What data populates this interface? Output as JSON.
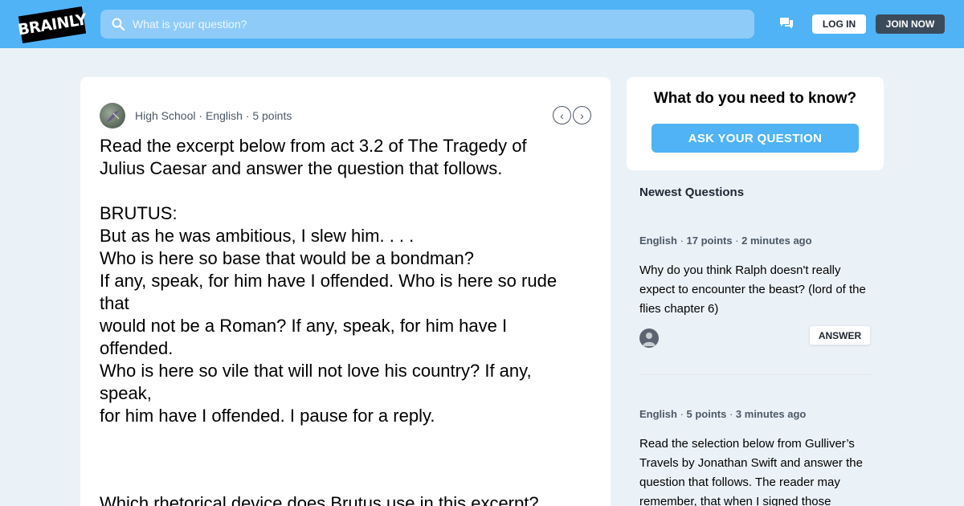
{
  "header": {
    "logo_text": "BRAINLY",
    "search_placeholder": "What is your question?",
    "login_label": "LOG IN",
    "join_label": "JOIN NOW",
    "icons": [
      "search-icon",
      "messages-icon"
    ],
    "colors": {
      "bar": "#4fb3f6",
      "join_bg": "#3c4b5b"
    }
  },
  "question": {
    "level": "High School",
    "subject": "English",
    "points": "5 points",
    "prev_glyph": "‹",
    "next_glyph": "›",
    "body": "Read the excerpt below from act 3.2 of The Tragedy of\nJulius Caesar and answer the question that follows.\n\nBRUTUS:\nBut as he was ambitious, I slew him. . . .\nWho is here so base that would be a bondman?\nIf any, speak, for him have I offended. Who is here so rude\nthat\nwould not be a Roman? If any, speak, for him have I\noffended.\nWho is here so vile that will not love his country? If any,\nspeak,\nfor him have I offended. I pause for a reply.",
    "prompt": "Which rhetorical device does Brutus use in this excerpt?"
  },
  "sidebar": {
    "ask_title": "What do you need to know?",
    "ask_button": "ASK YOUR QUESTION",
    "newest_title": "Newest Questions",
    "items": [
      {
        "subject": "English",
        "points": "17 points",
        "time": "2 minutes ago",
        "text": "Why do you think Ralph doesn't really expect to encounter the beast? (lord of the flies chapter 6)",
        "answer_label": "ANSWER"
      },
      {
        "subject": "English",
        "points": "5 points",
        "time": "3 minutes ago",
        "text": "Read the selection below from Gulliver’s Travels by Jonathan Swift and answer the question that follows. The reader may remember, that when I signed those"
      }
    ]
  }
}
